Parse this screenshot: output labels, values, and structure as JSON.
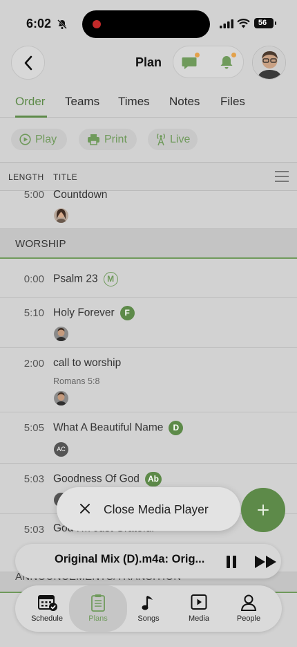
{
  "status": {
    "time": "6:02",
    "battery": "56"
  },
  "header": {
    "title": "Plan"
  },
  "tabs": [
    {
      "label": "Order",
      "active": true
    },
    {
      "label": "Teams"
    },
    {
      "label": "Times"
    },
    {
      "label": "Notes"
    },
    {
      "label": "Files"
    }
  ],
  "actions": {
    "play": "Play",
    "print": "Print",
    "live": "Live"
  },
  "table": {
    "col_length": "LENGTH",
    "col_title": "TITLE"
  },
  "rows": {
    "countdown": {
      "length": "5:00",
      "title": "Countdown"
    },
    "psalm": {
      "length": "0:00",
      "title": "Psalm 23",
      "key": "M"
    },
    "holy": {
      "length": "5:10",
      "title": "Holy Forever",
      "key": "F"
    },
    "call": {
      "length": "2:00",
      "title": "call to worship",
      "sub": "Romans 5:8"
    },
    "beautiful": {
      "length": "5:05",
      "title": "What A Beautiful Name",
      "key": "D",
      "person": "AC"
    },
    "goodness": {
      "length": "5:03",
      "title": "Goodness Of God",
      "key": "Ab"
    },
    "grateful": {
      "length": "5:03",
      "title": "God I'm Just Grateful"
    }
  },
  "sections": {
    "worship": "WORSHIP",
    "announcements": "ANNOUNCEMENTS/TRANSITION"
  },
  "media": {
    "close_label": "Close Media Player",
    "track": "Original Mix (D).m4a: Orig..."
  },
  "tabbar": {
    "schedule": "Schedule",
    "plans": "Plans",
    "songs": "Songs",
    "media": "Media",
    "people": "People"
  },
  "colors": {
    "accent": "#5d8a49",
    "notification": "#e3a14a"
  }
}
